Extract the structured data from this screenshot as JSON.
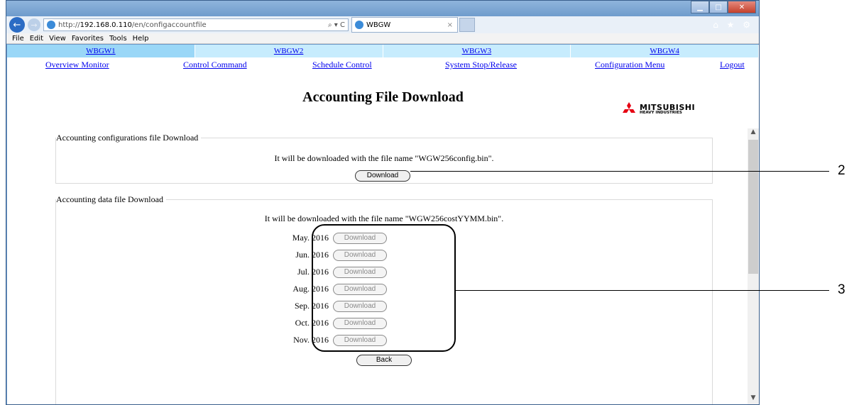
{
  "browser": {
    "address_prefix": "http://",
    "address_host": "192.168.0.110",
    "address_path": "/en/configaccountfile",
    "address_tools": "⌕ ▾ C",
    "tab_title": "WBGW",
    "tab_close": "×",
    "menu": [
      "File",
      "Edit",
      "View",
      "Favorites",
      "Tools",
      "Help"
    ],
    "right_icons": "⌂ ★ ⚙"
  },
  "gateway_tabs": [
    "WBGW1",
    "WBGW2",
    "WBGW3",
    "WBGW4"
  ],
  "nav": {
    "overview": "Overview Monitor",
    "control": "Control Command",
    "schedule": "Schedule Control",
    "stop_release": "System Stop/Release",
    "config_menu": "Configuration Menu",
    "logout": "Logout"
  },
  "page_title": "Accounting File Download",
  "logo": {
    "line1": "MITSUBISHI",
    "line2": "HEAVY INDUSTRIES",
    "color": "#e60012"
  },
  "config_section": {
    "legend": "Accounting configurations file Download",
    "note": "It will be downloaded with the file name \"WGW256config.bin\".",
    "button": "Download"
  },
  "data_section": {
    "legend": "Accounting data file Download",
    "note": "It will be downloaded with the file name \"WGW256costYYMM.bin\".",
    "months": [
      {
        "label": "May. 2016",
        "button": "Download"
      },
      {
        "label": "Jun. 2016",
        "button": "Download"
      },
      {
        "label": "Jul. 2016",
        "button": "Download"
      },
      {
        "label": "Aug. 2016",
        "button": "Download"
      },
      {
        "label": "Sep. 2016",
        "button": "Download"
      },
      {
        "label": "Oct. 2016",
        "button": "Download"
      },
      {
        "label": "Nov. 2016",
        "button": "Download"
      }
    ]
  },
  "back_button": "Back",
  "callouts": {
    "config": "2",
    "months": "3"
  }
}
